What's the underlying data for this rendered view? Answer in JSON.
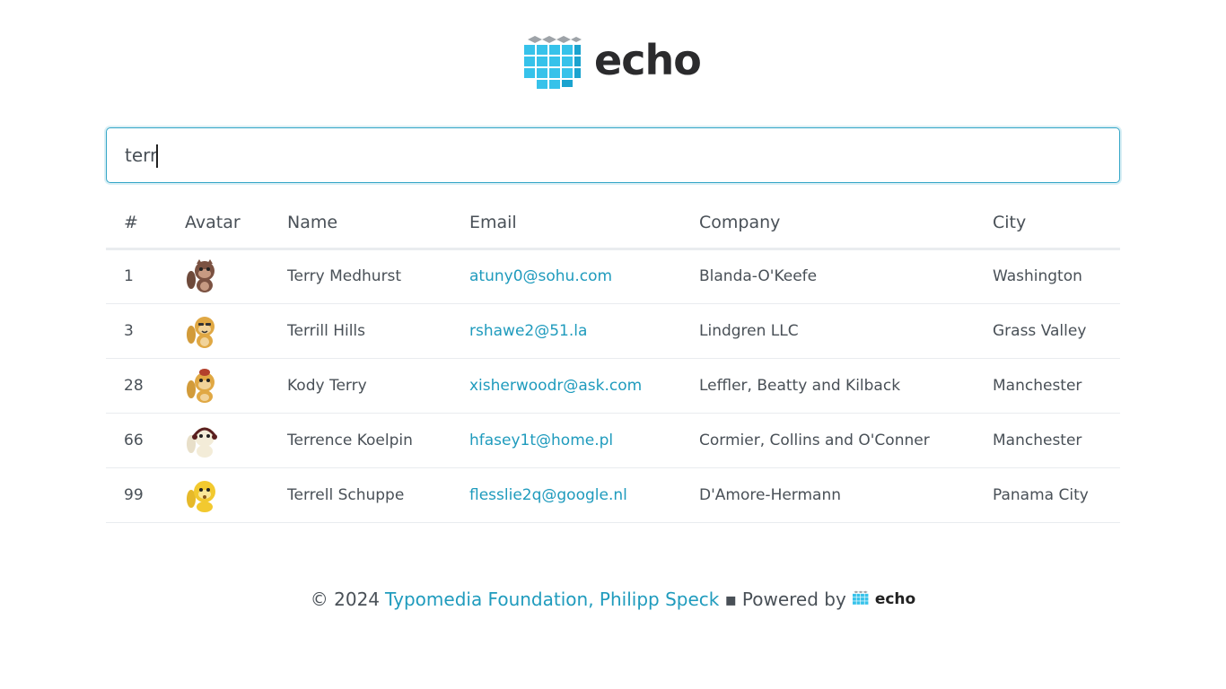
{
  "brand": {
    "name": "echo",
    "icon": "cube-grid-logo-icon"
  },
  "search": {
    "value": "terr"
  },
  "table": {
    "headers": [
      "#",
      "Avatar",
      "Name",
      "Email",
      "Company",
      "City"
    ],
    "rows": [
      {
        "id": "1",
        "avatar": "monkey-brown",
        "name": "Terry Medhurst",
        "email": "atuny0@sohu.com",
        "company": "Blanda-O'Keefe",
        "city": "Washington"
      },
      {
        "id": "3",
        "avatar": "monkey-orange-glasses",
        "name": "Terrill Hills",
        "email": "rshawe2@51.la",
        "company": "Lindgren LLC",
        "city": "Grass Valley"
      },
      {
        "id": "28",
        "avatar": "monkey-orange-hat",
        "name": "Kody Terry",
        "email": "xisherwoodr@ask.com",
        "company": "Leffler, Beatty and Kilback",
        "city": "Manchester"
      },
      {
        "id": "66",
        "avatar": "monkey-white-headphones",
        "name": "Terrence Koelpin",
        "email": "hfasey1t@home.pl",
        "company": "Cormier, Collins and O'Conner",
        "city": "Manchester"
      },
      {
        "id": "99",
        "avatar": "monkey-yellow",
        "name": "Terrell Schuppe",
        "email": "flesslie2q@google.nl",
        "company": "D'Amore-Hermann",
        "city": "Panama City"
      }
    ]
  },
  "footer": {
    "copyright": "© 2024",
    "link_text": "Typomedia Foundation, Philipp Speck",
    "separator": "▪",
    "powered_by": "Powered by",
    "brand": "echo"
  },
  "colors": {
    "accent": "#1f9bbd",
    "focus_border": "#33a6c7",
    "text": "#495057"
  }
}
